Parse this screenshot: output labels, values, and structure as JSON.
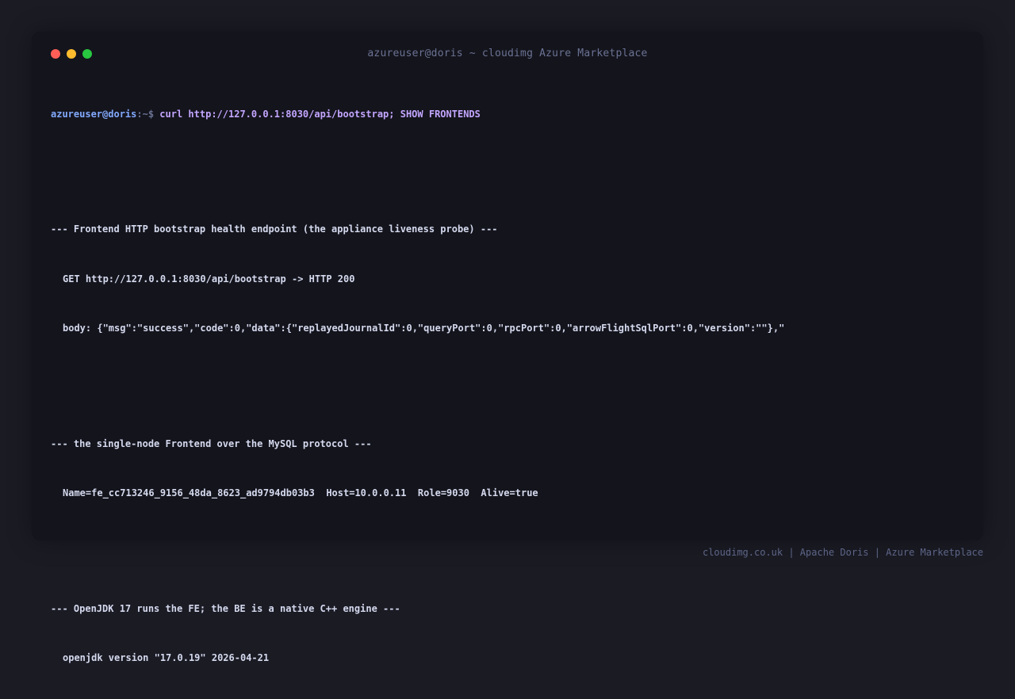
{
  "window": {
    "title": "azureuser@doris ~ cloudimg Azure Marketplace",
    "colors": {
      "close": "#ff5f57",
      "minimize": "#febc2e",
      "maximize": "#28c840"
    }
  },
  "terminal": {
    "prompt_user": "azureuser@doris",
    "prompt_sep": ":~$",
    "command": "curl http://127.0.0.1:8030/api/bootstrap; SHOW FRONTENDS",
    "sections": [
      {
        "header": "--- Frontend HTTP bootstrap health endpoint (the appliance liveness probe) ---",
        "lines": [
          "GET http://127.0.0.1:8030/api/bootstrap -> HTTP 200",
          "body: {\"msg\":\"success\",\"code\":0,\"data\":{\"replayedJournalId\":0,\"queryPort\":0,\"rpcPort\":0,\"arrowFlightSqlPort\":0,\"version\":\"\"},\""
        ]
      },
      {
        "header": "--- the single-node Frontend over the MySQL protocol ---",
        "lines": [
          "Name=fe_cc713246_9156_48da_8623_ad9794db03b3  Host=10.0.0.11  Role=9030  Alive=true"
        ]
      },
      {
        "header": "--- OpenJDK 17 runs the FE; the BE is a native C++ engine ---",
        "lines": [
          "openjdk version \"17.0.19\" 2026-04-21"
        ]
      }
    ]
  },
  "footer": {
    "text": "cloudimg.co.uk | Apache Doris | Azure Marketplace"
  }
}
